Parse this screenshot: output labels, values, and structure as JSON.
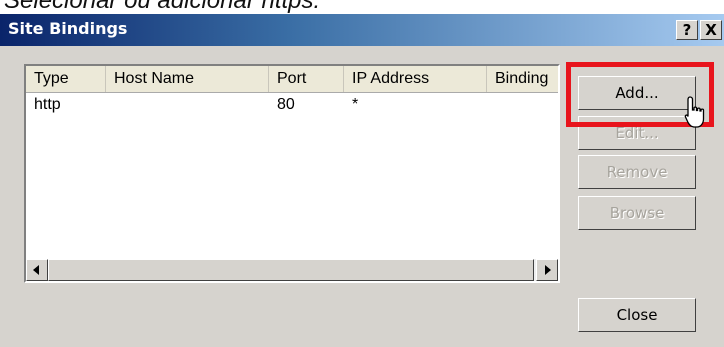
{
  "caption": "Selecionar ou adicionar https:",
  "window": {
    "title": "Site Bindings",
    "help_button": "?",
    "close_button": "X"
  },
  "list": {
    "columns": [
      "Type",
      "Host Name",
      "Port",
      "IP Address",
      "Binding"
    ],
    "rows": [
      {
        "type": "http",
        "host_name": "",
        "port": "80",
        "ip_address": "*",
        "binding": ""
      }
    ]
  },
  "buttons": {
    "add": "Add...",
    "edit": "Edit...",
    "remove": "Remove",
    "browse": "Browse",
    "close": "Close"
  },
  "icons": {
    "scroll_left": "scroll-left-arrow-icon",
    "scroll_right": "scroll-right-arrow-icon",
    "cursor": "mouse-pointer-icon"
  },
  "colors": {
    "highlight": "#e8141c",
    "title_start": "#0a246a",
    "title_end": "#a6caf0"
  }
}
